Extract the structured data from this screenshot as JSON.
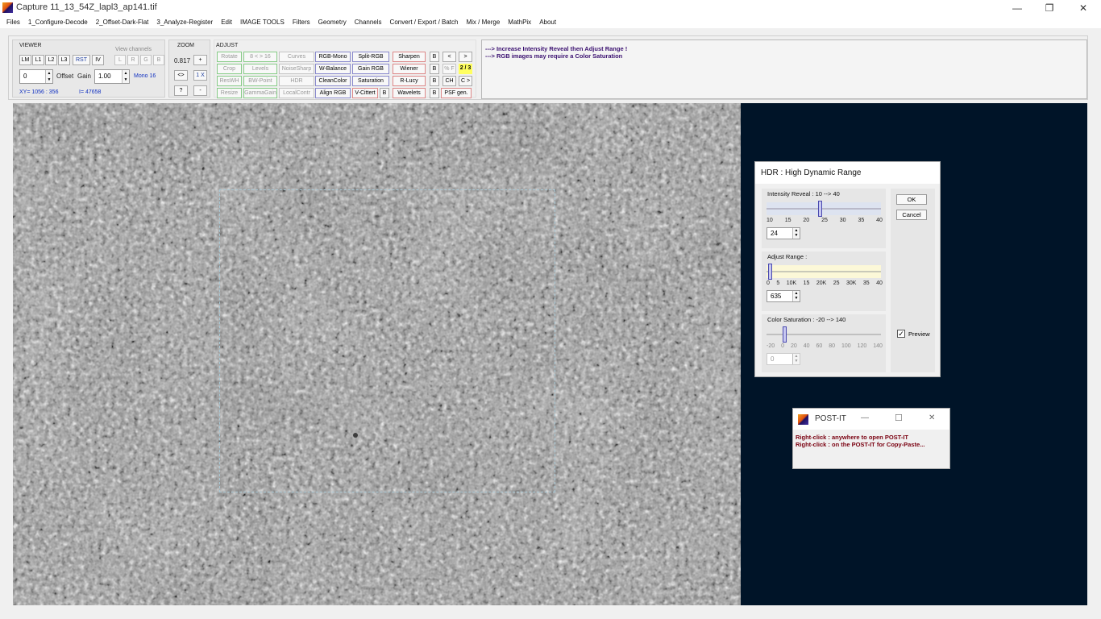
{
  "window": {
    "title": "Capture 11_13_54Z_lapl3_ap141.tif",
    "minimize": "—",
    "restore": "❐",
    "close": "✕"
  },
  "menu": [
    "Files",
    "1_Configure-Decode",
    "2_Offset-Dark-Flat",
    "3_Analyze-Register",
    "Edit",
    "IMAGE TOOLS",
    "Filters",
    "Geometry",
    "Channels",
    "Convert / Export / Batch",
    "Mix / Merge",
    "MathPix",
    "About"
  ],
  "viewer": {
    "label": "VIEWER",
    "buttons": [
      "LM",
      "L1",
      "L2",
      "L3",
      "RST",
      "IV"
    ],
    "view_channels_label": "View channels",
    "channels": [
      "L",
      "R",
      "G",
      "B"
    ],
    "offset_value": "0",
    "offset_label": "Offset",
    "gain_label": "Gain",
    "gain_value": "1.00",
    "mode": "Mono 16",
    "xy": "XY=  1056 : 356",
    "intensity": "I=  47658"
  },
  "zoom": {
    "label": "ZOOM",
    "value": "0.817",
    "plus": "+",
    "fit": "<>",
    "one_x": "1 X",
    "help": "?",
    "minus": "-"
  },
  "adjust": {
    "label": "ADJUST",
    "col1": [
      "Rotate",
      "Crop",
      "ResWH",
      "Resize"
    ],
    "col2": [
      "8 < > 16",
      "Levels",
      "BW-Point",
      "GammaGain"
    ],
    "col3": [
      "Curves",
      "NoiseSharp",
      "HDR",
      "LocalContr"
    ],
    "col4": [
      "RGB-Mono",
      "W-Balance",
      "CleanColor",
      "Align RGB"
    ],
    "col5": [
      "Split-RGB",
      "Gain RGB",
      "Saturation",
      "V-Cittert"
    ],
    "col6": [
      "Sharpen",
      "Wiener",
      "R-Lucy",
      "Wavelets"
    ],
    "b_label": "B",
    "nav_prev": "<",
    "nav_next": ">",
    "pct_f": "% F",
    "page": "2 / 3",
    "ch": "CH",
    "c_next": "C >",
    "psf": "PSF gen."
  },
  "messages": [
    "--->  Increase Intensity Reveal then Adjust Range !",
    "--->  RGB images may require a Color Saturation"
  ],
  "hdr_dialog": {
    "title": "HDR : High Dynamic Range",
    "intensity": {
      "label": "Intensity Reveal :  10  --> 40",
      "ticks": [
        "10",
        "15",
        "20",
        "25",
        "30",
        "35",
        "40"
      ],
      "value": "24",
      "level": 24,
      "min": 10,
      "max": 40
    },
    "range": {
      "label": "Adjust Range  :",
      "ticks": [
        "0",
        "5",
        "10K",
        "15",
        "20K",
        "25",
        "30K",
        "35",
        "40"
      ],
      "value": "635",
      "level": 0.01
    },
    "saturation": {
      "label": "Color Saturation :  -20  --> 140",
      "ticks": [
        "-20",
        "0",
        "20",
        "40",
        "60",
        "80",
        "100",
        "120",
        "140"
      ],
      "value": "0",
      "level": 0
    },
    "ok": "OK",
    "cancel": "Cancel",
    "preview_label": "Preview",
    "preview_checked": true
  },
  "postit": {
    "title": "POST-IT",
    "minimize": "—",
    "maximize": "☐",
    "close": "✕",
    "line1": "Right-click : anywhere to open POST-IT",
    "line2": "Right-click : on the POST-IT for Copy-Paste..."
  }
}
